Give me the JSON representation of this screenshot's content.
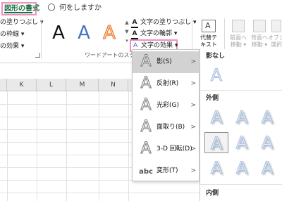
{
  "tabs": {
    "active": "図形の書式",
    "tell_me": "何をしますか"
  },
  "ribbon": {
    "shape_styles": [
      "の塗りつぶし ▾",
      "の枠線 ▾",
      "の効果 ▾"
    ],
    "wordart_label": "ワードアートのスタイ",
    "wordart_quick_styles": [
      "A",
      "A",
      "A"
    ],
    "text_options": {
      "fill": "文字の塗りつぶし ▾",
      "outline": "文字の輪郭 ▾",
      "effect": "文字の効果 ▾"
    },
    "textbox_button": [
      "代替テ",
      "キスト"
    ],
    "arrange": {
      "forward": [
        "前面へ",
        "移動 ▾"
      ],
      "backward": [
        "背面へ",
        "移動 ▾"
      ],
      "selection": [
        "オブジ",
        "選択"
      ]
    }
  },
  "sheet": {
    "columns": [
      "K",
      "L",
      "M",
      "N"
    ]
  },
  "text_effects_menu": {
    "items": [
      {
        "label": "影(S)",
        "icon": "A",
        "arrow": ">"
      },
      {
        "label": "反射(R)",
        "icon": "A",
        "arrow": ">"
      },
      {
        "label": "光彩(G)",
        "icon": "A",
        "arrow": ">"
      },
      {
        "label": "面取り(B)",
        "icon": "A",
        "arrow": ">"
      },
      {
        "label": "3-D 回転(D)",
        "icon": "A",
        "arrow": ">"
      },
      {
        "label": "変形(T)",
        "icon": "abc",
        "arrow": ">"
      }
    ]
  },
  "shadow_gallery": {
    "no_shadow_heading": "影なし",
    "no_shadow_item": "A",
    "outer_heading": "外側",
    "outer_items": [
      "A",
      "A",
      "A",
      "A",
      "A",
      "A",
      "A",
      "A",
      "A"
    ],
    "inner_heading": "内側"
  },
  "colors": {
    "accent_tab": "#1e7145",
    "highlight_border": "#ef8fc2",
    "menu_selected": "#d2d2d2"
  }
}
